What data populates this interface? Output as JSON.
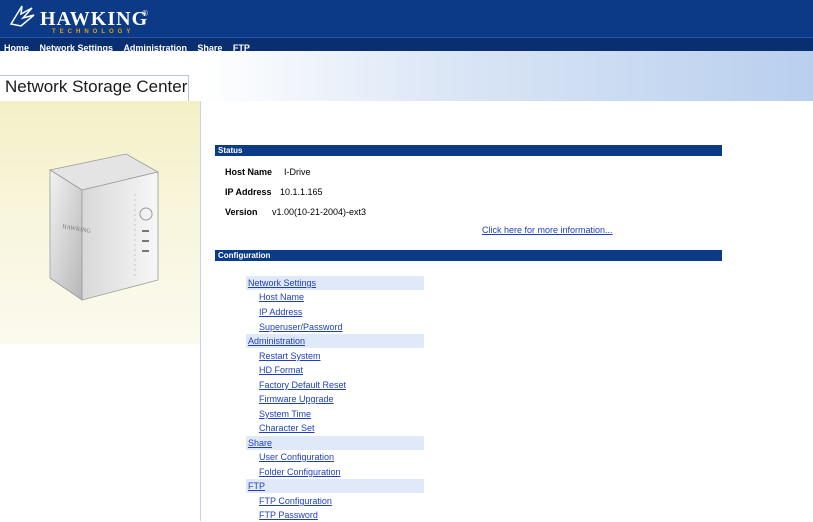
{
  "brand": {
    "name": "HAWKING",
    "sub": "TECHNOLOGY",
    "reg": "®"
  },
  "nav": [
    {
      "label": "Home"
    },
    {
      "label": "Network Settings"
    },
    {
      "label": "Administration"
    },
    {
      "label": "Share"
    },
    {
      "label": "FTP"
    }
  ],
  "page_title": "Network Storage Center",
  "status": {
    "header": "Status",
    "host_name_label": "Host Name",
    "host_name": "I-Drive",
    "ip_label": "IP Address",
    "ip": "10.1.1.165",
    "version_label": "Version",
    "version": "v1.00(10-21-2004)-ext3",
    "more_link": "Click here for more information..."
  },
  "config": {
    "header": "Configuration",
    "items": [
      {
        "label": "Network Settings",
        "level": "group"
      },
      {
        "label": "Host Name",
        "level": "sub"
      },
      {
        "label": "IP Address",
        "level": "sub"
      },
      {
        "label": "Superuser/Password",
        "level": "sub"
      },
      {
        "label": "Administration",
        "level": "group"
      },
      {
        "label": "Restart System",
        "level": "sub"
      },
      {
        "label": "HD Format",
        "level": "sub"
      },
      {
        "label": "Factory Default Reset",
        "level": "sub"
      },
      {
        "label": "Firmware Upgrade",
        "level": "sub"
      },
      {
        "label": "System Time",
        "level": "sub"
      },
      {
        "label": "Character Set",
        "level": "sub"
      },
      {
        "label": "Share",
        "level": "group"
      },
      {
        "label": "User Configuration",
        "level": "sub"
      },
      {
        "label": "Folder Configuration",
        "level": "sub"
      },
      {
        "label": "FTP",
        "level": "group"
      },
      {
        "label": "FTP Configuration",
        "level": "sub"
      },
      {
        "label": "FTP Password",
        "level": "sub"
      }
    ]
  },
  "colors": {
    "header_bg": "#0c3a86",
    "nav_bg": "#0a2f70",
    "section_bar": "#0b3a88",
    "link": "#1f3fbf",
    "group_bg": "#dfe9f7"
  }
}
